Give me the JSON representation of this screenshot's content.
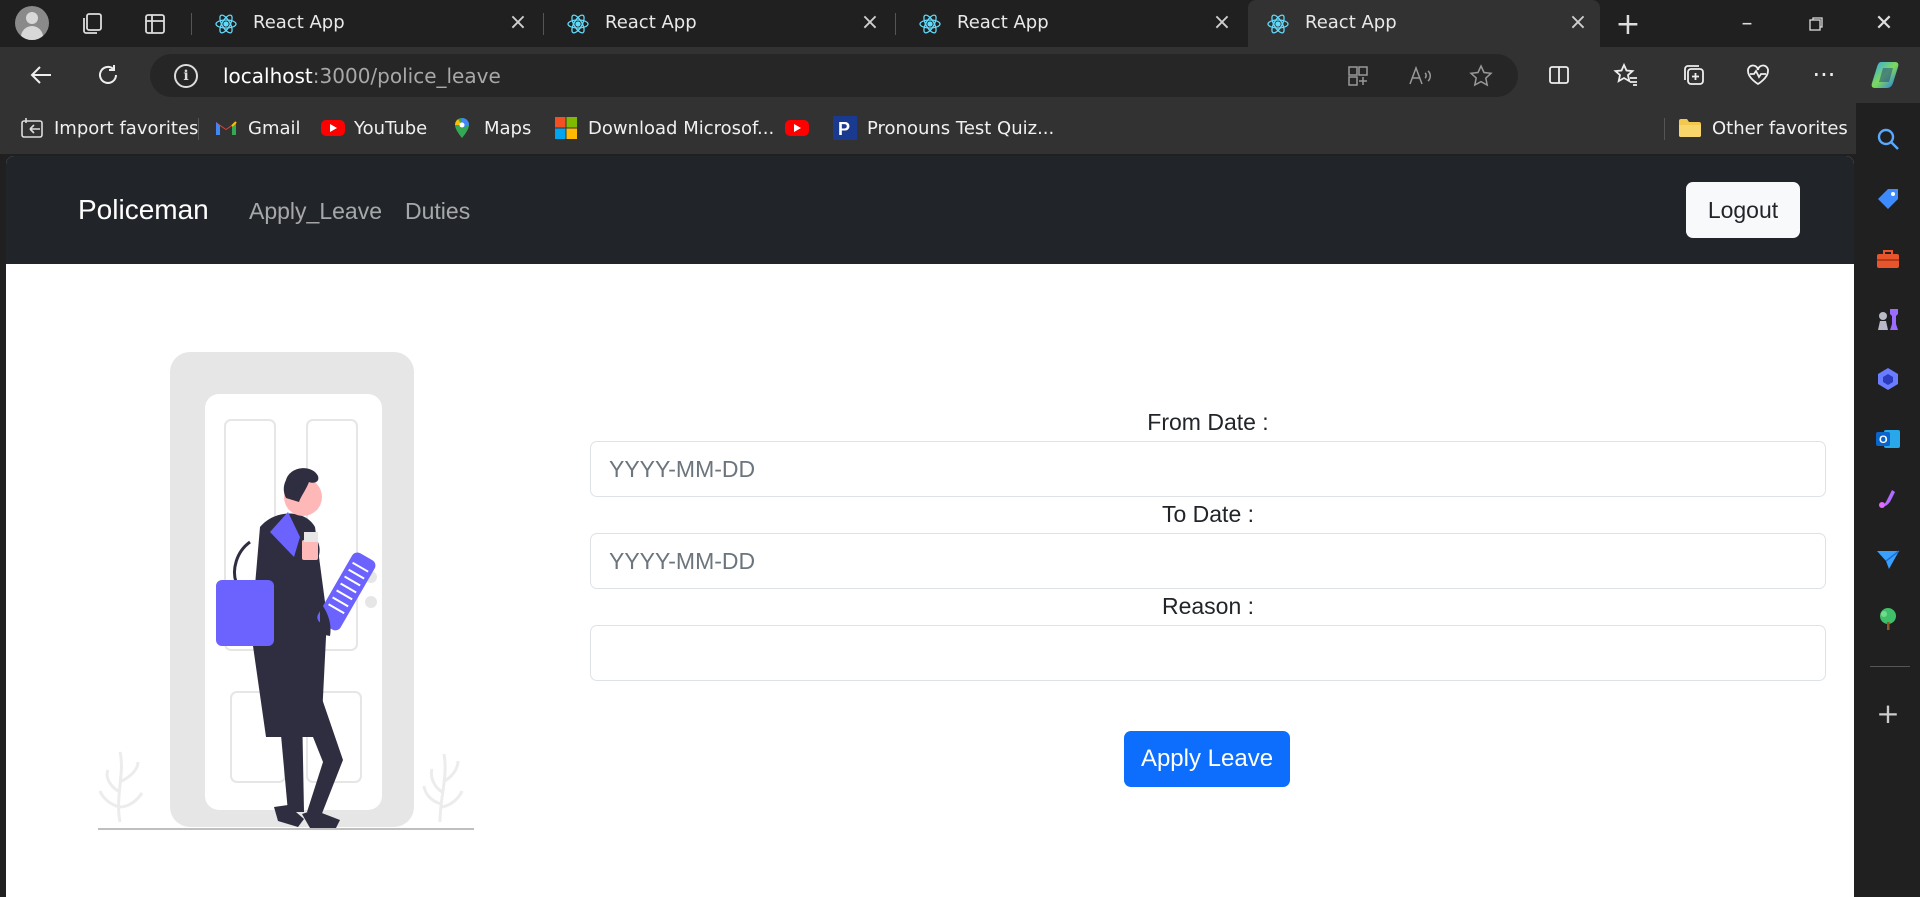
{
  "browser": {
    "tabs": [
      {
        "title": "React App",
        "active": false
      },
      {
        "title": "React App",
        "active": false
      },
      {
        "title": "React App",
        "active": false
      },
      {
        "title": "React App",
        "active": true
      }
    ],
    "address": {
      "host": "localhost",
      "rest": ":3000/police_leave"
    },
    "favorites": [
      {
        "label": "Import favorites",
        "icon": "import-favorites-icon"
      },
      {
        "label": "Gmail",
        "icon": "gmail-icon"
      },
      {
        "label": "YouTube",
        "icon": "youtube-icon"
      },
      {
        "label": "Maps",
        "icon": "maps-icon"
      },
      {
        "label": "Download Microsof...",
        "icon": "microsoft-icon"
      },
      {
        "label": "",
        "icon": "youtube-icon"
      },
      {
        "label": "Pronouns Test Quiz...",
        "icon": "p-icon"
      }
    ],
    "other_favorites": "Other favorites"
  },
  "app": {
    "brand": "Policeman",
    "nav_links": [
      "Apply_Leave",
      "Duties"
    ],
    "logout_label": "Logout"
  },
  "form": {
    "from_label": "From Date :",
    "from_placeholder": "YYYY-MM-DD",
    "to_label": "To Date :",
    "to_placeholder": "YYYY-MM-DD",
    "reason_label": "Reason :",
    "reason_placeholder": "",
    "submit_label": "Apply Leave"
  },
  "colors": {
    "primary": "#0d6efd",
    "navbar": "#212529",
    "illustration_accent": "#6c63ff"
  }
}
